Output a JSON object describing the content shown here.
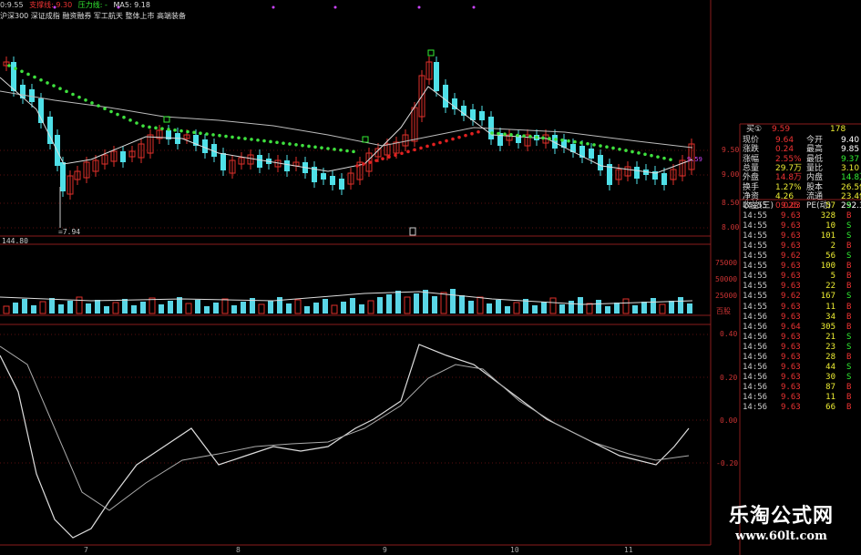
{
  "topbar": {
    "time": "0:9.55",
    "tag1": "支撑线: 9.30",
    "tag2": "压力线: -",
    "ma": "MA5: 9.18"
  },
  "concepts": "沪深300 深证成指 融资融券 军工航天 整体上市 高端装备",
  "price_axis": [
    "9.50",
    "9.00",
    "8.50",
    "8.00"
  ],
  "low_label": "=7.94",
  "volume_header": "144.80",
  "volume_axis": [
    "75000",
    "50000",
    "25000"
  ],
  "volume_unit": "百股",
  "macd_axis": [
    "0.40",
    "0.20",
    "0.00",
    "-0.20"
  ],
  "date_ticks": [
    "7",
    "8",
    "9",
    "10",
    "11"
  ],
  "price_tags": {
    "right_tag": "9.59",
    "mid_tag": "9.38"
  },
  "quote": {
    "buy1": {
      "label": "买①",
      "price": "9.59",
      "vol": "178"
    },
    "rows": [
      {
        "l1": "现价",
        "v1": "9.64",
        "l2": "今开",
        "v2": "9.40"
      },
      {
        "l1": "涨跌",
        "v1": "0.24",
        "l2": "最高",
        "v2": "9.85"
      },
      {
        "l1": "涨幅",
        "v1": "2.55%",
        "l2": "最低",
        "v2": "9.37"
      },
      {
        "l1": "总量",
        "v1": "29.7万",
        "l2": "量比",
        "v2": "3.10"
      },
      {
        "l1": "外盘",
        "v1": "14.8万",
        "l2": "内盘",
        "v2": "14.8万"
      },
      {
        "l1": "换手",
        "v1": "1.27%",
        "l2": "股本",
        "v2": "26.5亿"
      },
      {
        "l1": "净资",
        "v1": "4.26",
        "l2": "流通",
        "v2": "23.4亿"
      },
      {
        "l1": "收益(三)",
        "v1": "0.025",
        "l2": "PE(动)",
        "v2": "292.3"
      }
    ]
  },
  "ticks": [
    {
      "t": "14:55",
      "p": "9.63",
      "v": "57",
      "s": "S"
    },
    {
      "t": "14:55",
      "p": "9.63",
      "v": "328",
      "s": "B"
    },
    {
      "t": "14:55",
      "p": "9.63",
      "v": "10",
      "s": "S"
    },
    {
      "t": "14:55",
      "p": "9.63",
      "v": "101",
      "s": "S"
    },
    {
      "t": "14:55",
      "p": "9.63",
      "v": "2",
      "s": "B"
    },
    {
      "t": "14:55",
      "p": "9.62",
      "v": "56",
      "s": "S"
    },
    {
      "t": "14:55",
      "p": "9.63",
      "v": "100",
      "s": "B"
    },
    {
      "t": "14:55",
      "p": "9.63",
      "v": "5",
      "s": "B"
    },
    {
      "t": "14:55",
      "p": "9.63",
      "v": "22",
      "s": "B"
    },
    {
      "t": "14:55",
      "p": "9.62",
      "v": "167",
      "s": "S"
    },
    {
      "t": "14:55",
      "p": "9.63",
      "v": "11",
      "s": "B"
    },
    {
      "t": "14:56",
      "p": "9.63",
      "v": "34",
      "s": "B"
    },
    {
      "t": "14:56",
      "p": "9.64",
      "v": "305",
      "s": "B"
    },
    {
      "t": "14:56",
      "p": "9.63",
      "v": "21",
      "s": "S"
    },
    {
      "t": "14:56",
      "p": "9.63",
      "v": "23",
      "s": "S"
    },
    {
      "t": "14:56",
      "p": "9.63",
      "v": "28",
      "s": "B"
    },
    {
      "t": "14:56",
      "p": "9.63",
      "v": "44",
      "s": "S"
    },
    {
      "t": "14:56",
      "p": "9.63",
      "v": "30",
      "s": "S"
    },
    {
      "t": "14:56",
      "p": "9.63",
      "v": "87",
      "s": "B"
    },
    {
      "t": "14:56",
      "p": "9.63",
      "v": "11",
      "s": "B"
    },
    {
      "t": "14:56",
      "p": "9.63",
      "v": "66",
      "s": "B"
    }
  ],
  "colors": {
    "up": "#e0302a",
    "down": "#4fe0e8",
    "support_dots": "#3ee03e",
    "pressure_dots": "#e02020",
    "panel_border": "#8a1c1c",
    "volume_bar": "#5ad6e6"
  },
  "watermark": {
    "cn": "乐淘公式网",
    "url": "www.60lt.com"
  }
}
